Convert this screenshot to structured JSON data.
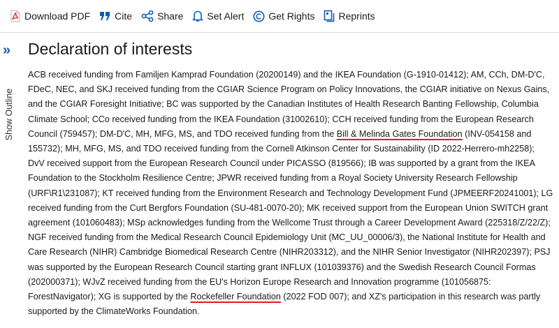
{
  "toolbar": {
    "download_pdf": "Download PDF",
    "cite": "Cite",
    "share": "Share",
    "set_alert": "Set Alert",
    "get_rights": "Get Rights",
    "reprints": "Reprints"
  },
  "sidebar": {
    "expand_glyph": "»",
    "show_outline": "Show Outline"
  },
  "section": {
    "title": "Declaration of interests",
    "text_1": "ACB received funding from Familjen Kamprad Foundation (20200149) and the IKEA Foundation (G-1910-01412); AM, CCh, DM-D'C, FDeC, NEC, and SKJ received funding from the CGIAR Science Program on Policy Innovations, the CGIAR initiative on Nexus Gains, and the CGIAR Foresight Initiative; BC was supported by the Canadian Institutes of Health Research Banting Fellowship, Columbia Climate School; CCo received funding from the IKEA Foundation (31002610); CCH received funding from the European Research Council (759457); DM-D'C, MH, MFG, MS, and TDO received funding from the ",
    "highlight_1": "Bill & Melinda Gates Foundation",
    "text_2": " (INV-054158 and 155732); MH, MFG, MS, and TDO received funding from the Cornell Atkinson Center for Sustainability (ID 2022-Herrero-mh2258); DvV received support from the European Research Council under PICASSO (819566); IB was supported by a grant from the IKEA Foundation to the Stockholm Resilience Centre; JPWR received funding from a Royal Society University Research Fellowship (URF\\R1\\231087); KT received funding from the Environment Research and Technology Development Fund (JPMEERF20241001); LG received funding from the Curt Bergfors Foundation (SU-481-0070-20); MK received support from the European Union SWITCH grant agreement (101060483); MSp acknowledges funding from the Wellcome Trust through a Career Development Award (225318/Z/22/Z); NGF received funding from the Medical Research Council Epidemiology Unit (MC_UU_00006/3), the National Institute for Health and Care Research (NIHR) Cambridge Biomedical Research Centre (NIHR203312), and the NIHR Senior Investigator (NIHR202397); PSJ was supported by the European Research Council starting grant INFLUX (101039376) and the Swedish Research Council Formas (202000371); WJvZ received funding from the EU's Horizon Europe Research and Innovation programme (101056875: ForestNavigator); XG is supported by the ",
    "highlight_2": "Rockefeller Foundation",
    "text_3": " (2022 FOD 007); and XZ's participation in this research was partly supported by the ClimateWorks Foundation."
  },
  "colors": {
    "accent": "#0d5bb5",
    "pdf_red": "#e4342b",
    "highlight_underline": "#e5191b"
  },
  "icons": [
    "pdf-icon",
    "quote-icon",
    "share-icon",
    "bell-icon",
    "copyright-icon",
    "reprints-icon",
    "chevron-double-right-icon"
  ]
}
